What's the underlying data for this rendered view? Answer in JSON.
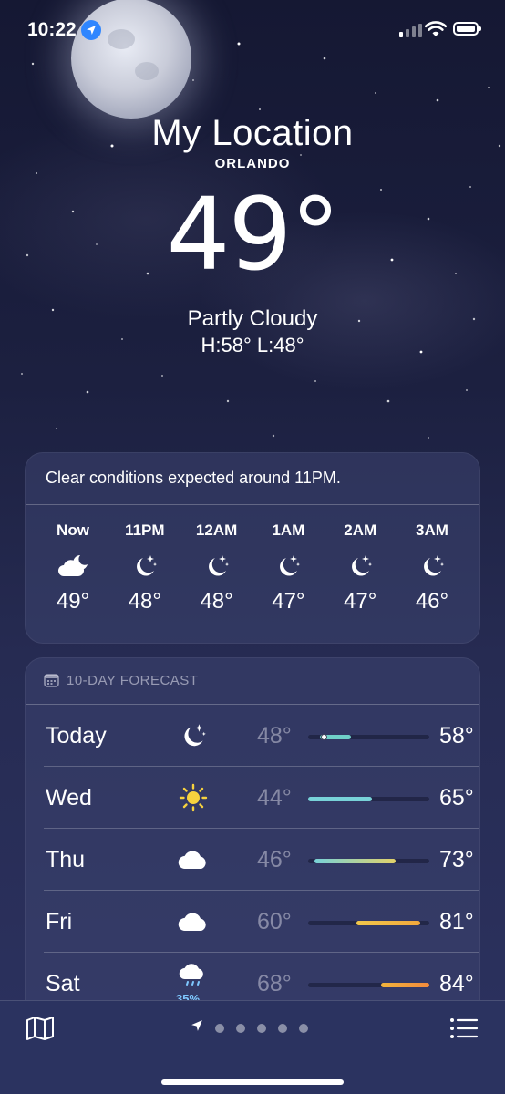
{
  "status_bar": {
    "time": "10:22"
  },
  "header": {
    "location_name": "My Location",
    "city": "ORLANDO",
    "temperature": "49°",
    "condition": "Partly Cloudy",
    "high_low": "H:58°  L:48°"
  },
  "hourly": {
    "summary": "Clear conditions expected around 11PM.",
    "hours": [
      {
        "label": "Now",
        "icon": "moon-cloud-icon",
        "temp": "49°"
      },
      {
        "label": "11PM",
        "icon": "moon-stars-icon",
        "temp": "48°"
      },
      {
        "label": "12AM",
        "icon": "moon-stars-icon",
        "temp": "48°"
      },
      {
        "label": "1AM",
        "icon": "moon-stars-icon",
        "temp": "47°"
      },
      {
        "label": "2AM",
        "icon": "moon-stars-icon",
        "temp": "47°"
      },
      {
        "label": "3AM",
        "icon": "moon-stars-icon",
        "temp": "46°"
      }
    ]
  },
  "ten_day": {
    "title": "10-DAY FORECAST",
    "range_min": 44,
    "range_max": 84,
    "days": [
      {
        "day": "Today",
        "icon": "moon-stars-icon",
        "precip": "",
        "low": "48°",
        "high": "58°",
        "low_value": 48,
        "high_value": 58,
        "current_value": 49,
        "bar_color": "#6fd0c8"
      },
      {
        "day": "Wed",
        "icon": "sun-icon",
        "precip": "",
        "low": "44°",
        "high": "65°",
        "low_value": 44,
        "high_value": 65,
        "bar_color": "#78d2d8"
      },
      {
        "day": "Thu",
        "icon": "cloud-icon",
        "precip": "",
        "low": "46°",
        "high": "73°",
        "low_value": 46,
        "high_value": 73,
        "bar_color": "linear-gradient(90deg,#78d2d8,#e2d26a)"
      },
      {
        "day": "Fri",
        "icon": "cloud-icon",
        "precip": "",
        "low": "60°",
        "high": "81°",
        "low_value": 60,
        "high_value": 81,
        "bar_color": "linear-gradient(90deg,#f2c84b,#f2a83c)"
      },
      {
        "day": "Sat",
        "icon": "cloud-rain-icon",
        "precip": "35%",
        "low": "68°",
        "high": "84°",
        "low_value": 68,
        "high_value": 84,
        "bar_color": "linear-gradient(90deg,#f2b43c,#f28a3c)"
      }
    ]
  }
}
